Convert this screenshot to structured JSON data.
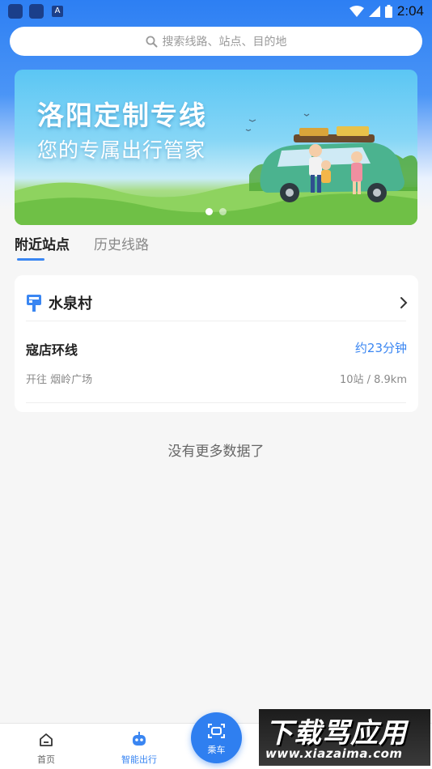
{
  "status_bar": {
    "time": "2:04",
    "icons": [
      "app-icon",
      "app-icon",
      "a-icon",
      "wifi-icon",
      "signal-icon",
      "battery-icon"
    ]
  },
  "search": {
    "placeholder": "搜索线路、站点、目的地",
    "icon": "search-icon"
  },
  "banner": {
    "title": "洛阳定制专线",
    "subtitle": "您的专属出行管家",
    "slides": 2,
    "active_slide": 1
  },
  "tabs": [
    {
      "label": "附近站点",
      "active": true
    },
    {
      "label": "历史线路",
      "active": false
    }
  ],
  "station": {
    "icon": "bus-stop-icon",
    "name": "水泉村",
    "routes": [
      {
        "name": "寇店环线",
        "eta": "约23分钟",
        "destination": "开往 烟岭广场",
        "distance": "10站 / 8.9km"
      }
    ]
  },
  "list_end_text": "没有更多数据了",
  "bottom_nav": [
    {
      "label": "首页",
      "icon": "home-icon",
      "active": false
    },
    {
      "label": "智能出行",
      "icon": "robot-icon",
      "active": true
    }
  ],
  "ride_button": {
    "label": "乘车",
    "icon": "scan-icon"
  },
  "watermark": {
    "title": "下载骂应用",
    "url": "www.xiazaima.com"
  },
  "colors": {
    "accent": "#3a86f2",
    "header_blue": "#2d7ff3",
    "background": "#f6f6f6"
  }
}
